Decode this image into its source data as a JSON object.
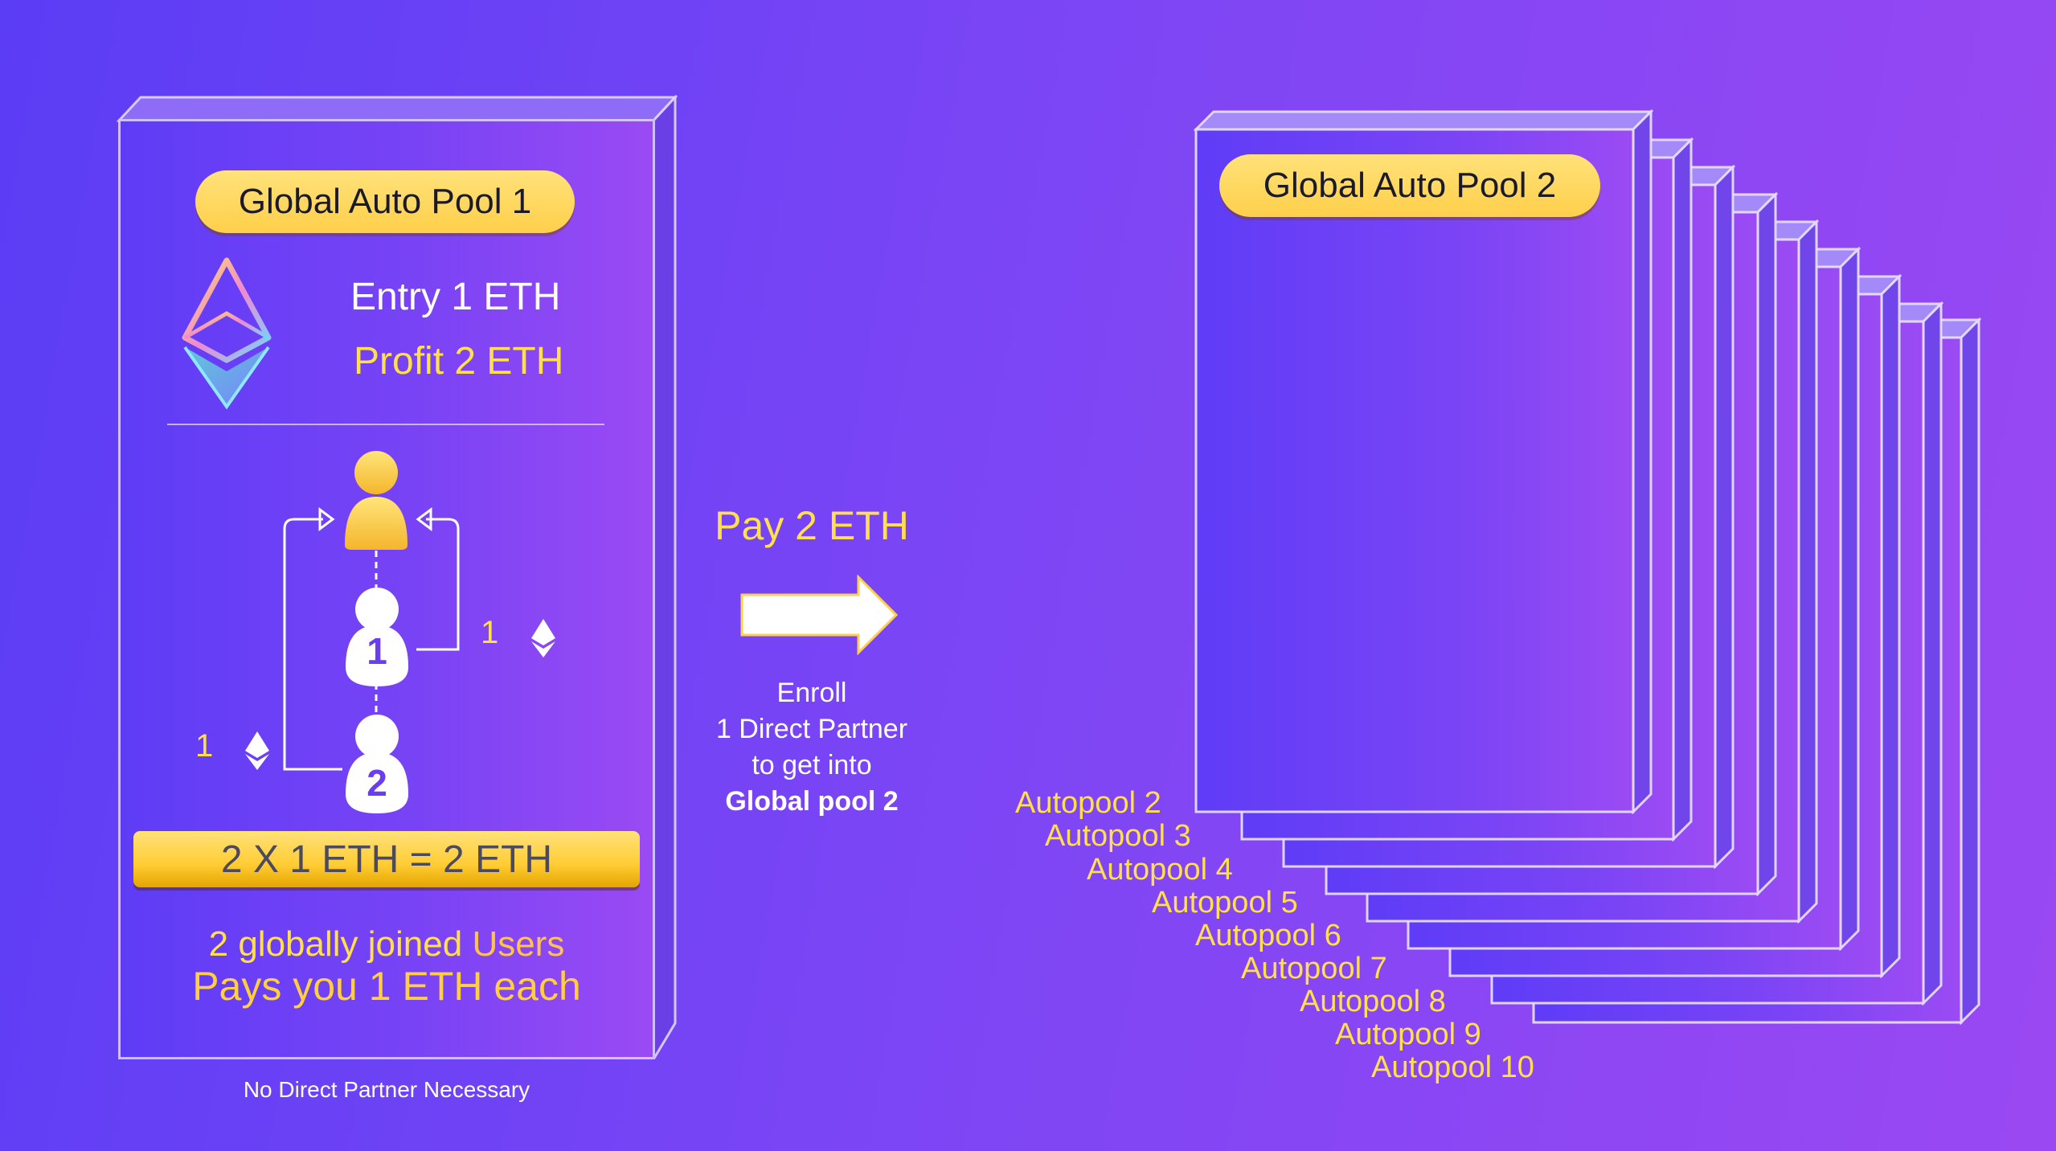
{
  "pool1": {
    "title": "Global Auto Pool 1",
    "entry": "Entry 1 ETH",
    "profit": "Profit 2 ETH",
    "left_amount": "1",
    "right_amount": "1",
    "user_1": "1",
    "user_2": "2",
    "equation": "2 X 1 ETH = 2 ETH",
    "joined_line_a": "2 globally joined",
    "joined_line_b": "Users",
    "pays_line": "Pays you 1 ETH each",
    "footnote": "No Direct Partner Necessary"
  },
  "middle": {
    "pay_label": "Pay 2 ETH",
    "enroll": "Enroll",
    "direct_partner": "1 Direct Partner",
    "to_get_into": "to get into",
    "global_pool": "Global pool 2"
  },
  "pool2": {
    "title": "Global Auto Pool 2",
    "autopools": [
      "Autopool 2",
      "Autopool 3",
      "Autopool 4",
      "Autopool 5",
      "Autopool 6",
      "Autopool 7",
      "Autopool 8",
      "Autopool 9",
      "Autopool 10"
    ]
  },
  "colors": {
    "accent_yellow": "#ffe04a",
    "pill_yellow": "#ffd65a",
    "background_start": "#5b3df5",
    "background_end": "#9a48f2"
  },
  "icons": [
    "ethereum-logo-icon",
    "ethereum-small-icon",
    "person-icon",
    "right-arrow-icon",
    "loop-arrow-icon"
  ]
}
